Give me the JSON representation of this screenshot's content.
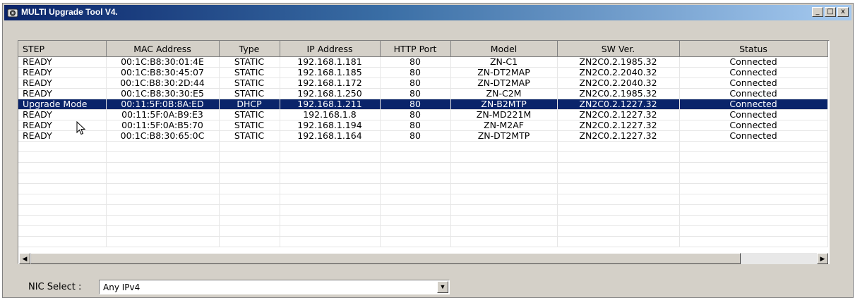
{
  "window": {
    "title": "MULTI Upgrade Tool V4.",
    "controls": {
      "minimize": "_",
      "maximize": "□",
      "close": "x"
    }
  },
  "table": {
    "columns": [
      "STEP",
      "MAC Address",
      "Type",
      "IP Address",
      "HTTP Port",
      "Model",
      "SW Ver.",
      "Status"
    ],
    "rows": [
      [
        "READY",
        "00:1C:B8:30:01:4E",
        "STATIC",
        "192.168.1.181",
        "80",
        "ZN-C1",
        "ZN2C0.2.1985.32",
        "Connected"
      ],
      [
        "READY",
        "00:1C:B8:30:45:07",
        "STATIC",
        "192.168.1.185",
        "80",
        "ZN-DT2MAP",
        "ZN2C0.2.2040.32",
        "Connected"
      ],
      [
        "READY",
        "00:1C:B8:30:2D:44",
        "STATIC",
        "192.168.1.172",
        "80",
        "ZN-DT2MAP",
        "ZN2C0.2.2040.32",
        "Connected"
      ],
      [
        "READY",
        "00:1C:B8:30:30:E5",
        "STATIC",
        "192.168.1.250",
        "80",
        "ZN-C2M",
        "ZN2C0.2.1985.32",
        "Connected"
      ],
      [
        "Upgrade Mode",
        "00:11:5F:0B:8A:ED",
        "DHCP",
        "192.168.1.211",
        "80",
        "ZN-B2MTP",
        "ZN2C0.2.1227.32",
        "Connected"
      ],
      [
        "READY",
        "00:11:5F:0A:B9:E3",
        "STATIC",
        "192.168.1.8",
        "80",
        "ZN-MD221M",
        "ZN2C0.2.1227.32",
        "Connected"
      ],
      [
        "READY",
        "00:11:5F:0A:B5:70",
        "STATIC",
        "192.168.1.194",
        "80",
        "ZN-M2AF",
        "ZN2C0.2.1227.32",
        "Connected"
      ],
      [
        "READY",
        "00:1C:B8:30:65:0C",
        "STATIC",
        "192.168.1.164",
        "80",
        "ZN-DT2MTP",
        "ZN2C0.2.1227.32",
        "Connected"
      ]
    ],
    "selected_row": 4,
    "empty_rows": 10
  },
  "scrollbar": {
    "left_arrow": "◀",
    "right_arrow": "▶"
  },
  "nic": {
    "label": "NIC Select :",
    "value": "Any IPv4",
    "arrow": "▼"
  },
  "colors": {
    "selection": "#0a246a",
    "titlebar": "#0a246a",
    "face": "#d4d0c8"
  }
}
